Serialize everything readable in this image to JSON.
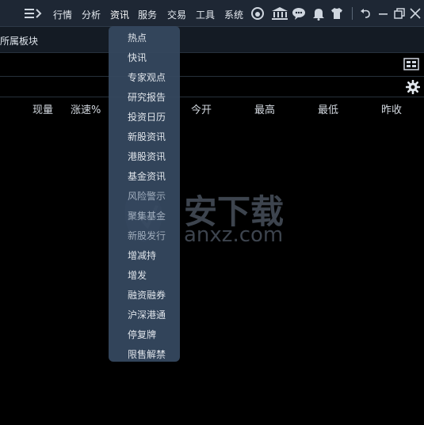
{
  "topbar": {
    "menus": [
      "行情",
      "分析",
      "资讯",
      "服务",
      "交易",
      "工具",
      "系统"
    ],
    "icons": [
      "menu-toggle-icon",
      "weibo-icon",
      "bank-icon",
      "chat-bubble-icon",
      "bell-icon",
      "shirt-icon",
      "undo-icon",
      "minimize-icon",
      "restore-icon",
      "close-icon"
    ]
  },
  "subbar": {
    "label": "所属板块"
  },
  "table": {
    "headers": [
      "现量",
      "涨速%",
      "今开",
      "最高",
      "最低",
      "昨收"
    ]
  },
  "dropdown": {
    "items": [
      "热点",
      "快讯",
      "专家观点",
      "研究报告",
      "投资日历",
      "新股资讯",
      "港股资讯",
      "基金资讯",
      "风险警示",
      "聚集基金",
      "新股发行",
      "增减持",
      "增发",
      "融资融券",
      "沪深港通",
      "停复牌",
      "限售解禁"
    ]
  },
  "watermark": {
    "title": "安下载",
    "domain": "anxz.com"
  },
  "colors": {
    "background": "#000000",
    "topbar": "#1e2734",
    "dropdown": "#35475e",
    "text": "#cfd6df"
  }
}
